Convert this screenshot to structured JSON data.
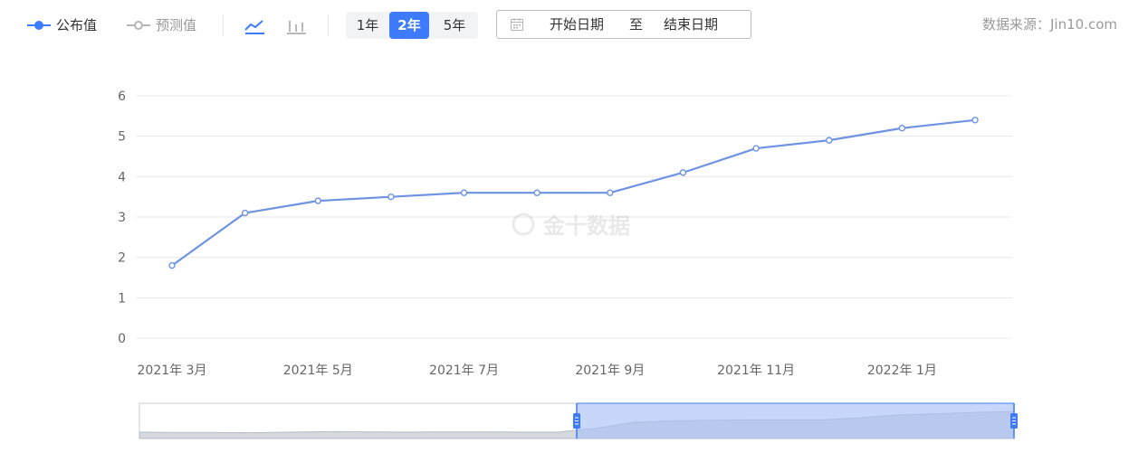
{
  "toolbar": {
    "legend_published": "公布值",
    "legend_forecast": "预测值",
    "range_options": [
      "1年",
      "2年",
      "5年"
    ],
    "range_selected": "2年",
    "start_date_placeholder": "开始日期",
    "date_separator": "至",
    "end_date_placeholder": "结束日期",
    "source": "数据来源：Jin10.com"
  },
  "watermark": "金十数据",
  "colors": {
    "series_line": "#6f93e3",
    "accent": "#3e7bfa",
    "forecast_gray": "#b5b5b5",
    "grid": "#e8e8e8",
    "axis_text": "#666666"
  },
  "icons": {
    "line_chart": "line-chart-icon",
    "bar_chart": "bar-chart-icon",
    "calendar": "calendar-icon"
  },
  "chart_data": {
    "type": "line",
    "x": [
      "2021-03",
      "2021-04",
      "2021-05",
      "2021-06",
      "2021-07",
      "2021-08",
      "2021-09",
      "2021-10",
      "2021-11",
      "2021-12",
      "2022-01",
      "2022-02"
    ],
    "x_tick_labels": [
      "2021年 3月",
      "2021年 5月",
      "2021年 7月",
      "2021年 9月",
      "2021年 11月",
      "2022年 1月"
    ],
    "series": [
      {
        "name": "公布值",
        "values": [
          1.8,
          3.1,
          3.4,
          3.5,
          3.6,
          3.6,
          3.6,
          4.1,
          4.7,
          4.9,
          5.2,
          5.4
        ]
      }
    ],
    "ylim": [
      0,
      6
    ],
    "yticks": [
      0,
      1,
      2,
      3,
      4,
      5,
      6
    ],
    "grid": true,
    "data_zoom": {
      "range": [
        0.5,
        1.0
      ],
      "overview": [
        1.0,
        0.9,
        0.9,
        0.85,
        1.0,
        1.1,
        1.05,
        1.0,
        1.05,
        1.05,
        1.0,
        1.0,
        1.8,
        3.1,
        3.4,
        3.5,
        3.6,
        3.6,
        3.6,
        4.1,
        4.7,
        4.9,
        5.2,
        5.4
      ]
    }
  }
}
